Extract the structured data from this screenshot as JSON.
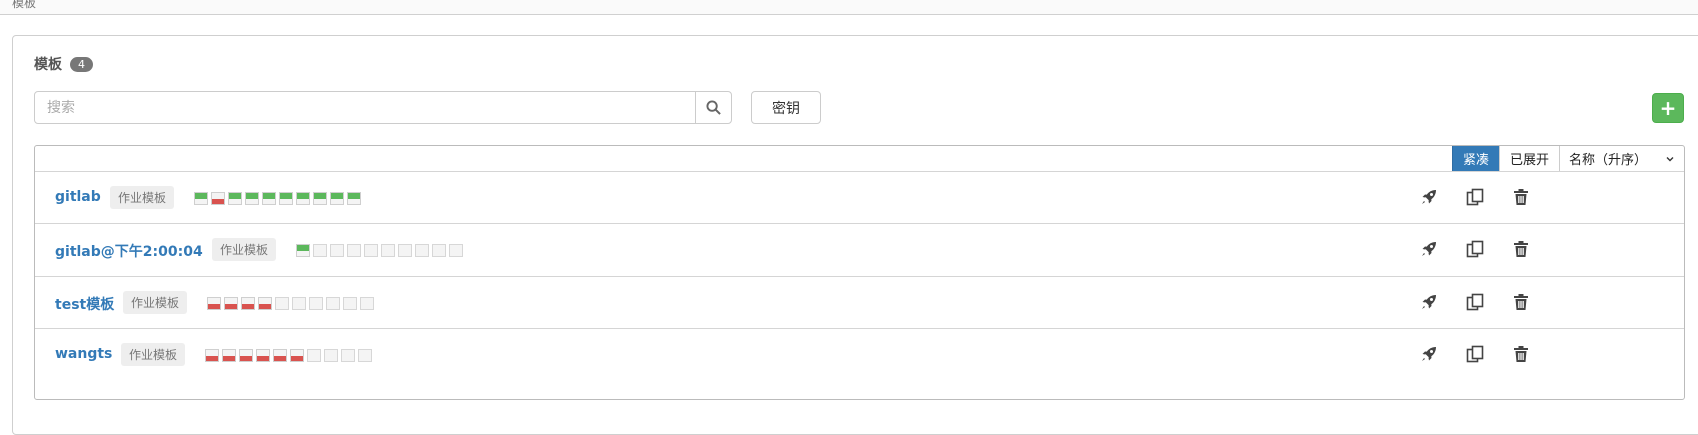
{
  "topbar": {
    "left_text": "模板",
    "right_text": ""
  },
  "panel": {
    "title": "模板",
    "count": "4",
    "search_placeholder": "搜索",
    "key_button": "密钥",
    "add_button": "+"
  },
  "list": {
    "view_compact": "紧凑",
    "view_expanded": "已展开",
    "sort_label": "名称（升序）",
    "rows": [
      {
        "name": "gitlab",
        "tag": "作业模板",
        "jobs": [
          "s",
          "f",
          "s",
          "s",
          "s",
          "s",
          "s",
          "s",
          "s",
          "s"
        ]
      },
      {
        "name": "gitlab@下午2:00:04",
        "tag": "作业模板",
        "jobs": [
          "s",
          "n",
          "n",
          "n",
          "n",
          "n",
          "n",
          "n",
          "n",
          "n"
        ]
      },
      {
        "name": "test模板",
        "tag": "作业模板",
        "jobs": [
          "f",
          "f",
          "f",
          "f",
          "n",
          "n",
          "n",
          "n",
          "n",
          "n"
        ]
      },
      {
        "name": "wangts",
        "tag": "作业模板",
        "jobs": [
          "f",
          "f",
          "f",
          "f",
          "f",
          "f",
          "n",
          "n",
          "n",
          "n"
        ]
      }
    ]
  },
  "colors": {
    "success": "#5cb85c",
    "failed": "#d9534f",
    "link": "#337ab7",
    "active_toggle": "#337ab7"
  },
  "icons": [
    "search-icon",
    "rocket-icon",
    "copy-icon",
    "trash-icon",
    "chevron-down-icon"
  ]
}
